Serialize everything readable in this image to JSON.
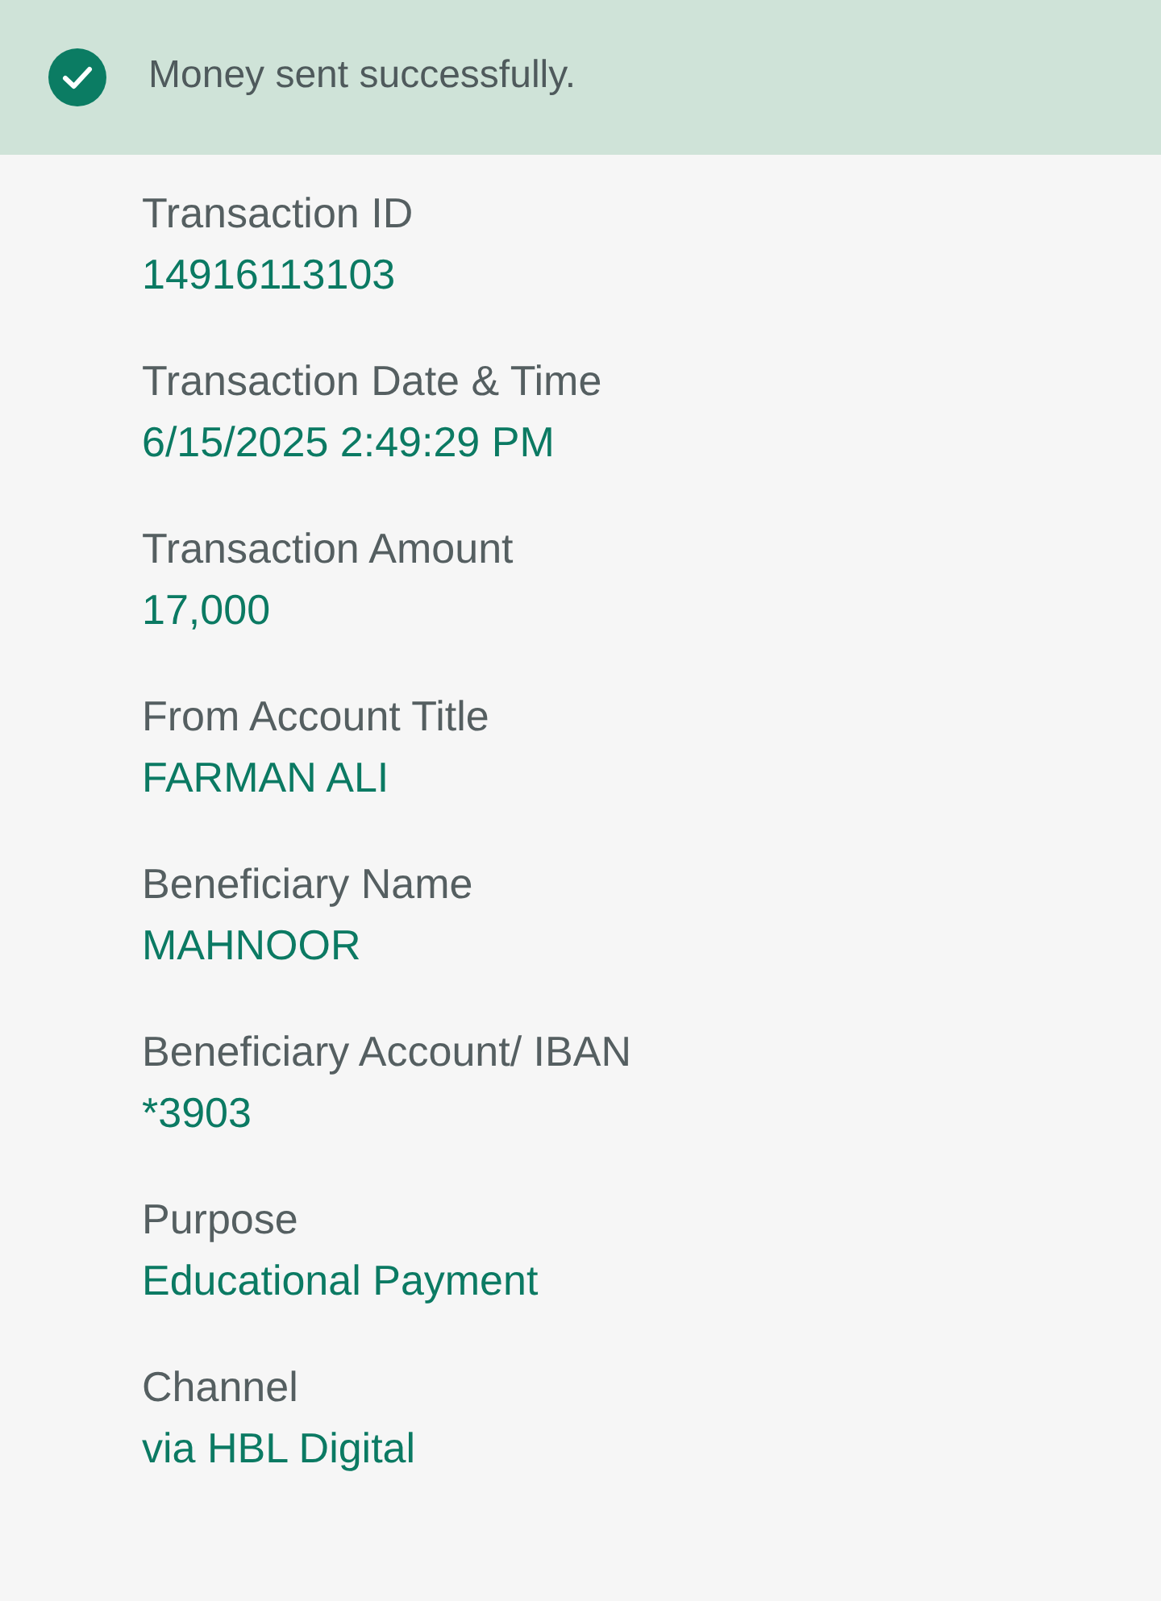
{
  "banner": {
    "kind": "success",
    "message": "Money sent successfully."
  },
  "details": [
    {
      "label": "Transaction ID",
      "value": "14916113103"
    },
    {
      "label": "Transaction Date & Time",
      "value": "6/15/2025 2:49:29 PM"
    },
    {
      "label": "Transaction Amount",
      "value": "17,000"
    },
    {
      "label": "From Account Title",
      "value": "FARMAN ALI"
    },
    {
      "label": "Beneficiary Name",
      "value": "MAHNOOR"
    },
    {
      "label": "Beneficiary Account/ IBAN",
      "value": "*3903"
    },
    {
      "label": "Purpose",
      "value": "Educational Payment"
    },
    {
      "label": "Channel",
      "value": "via HBL Digital"
    }
  ]
}
